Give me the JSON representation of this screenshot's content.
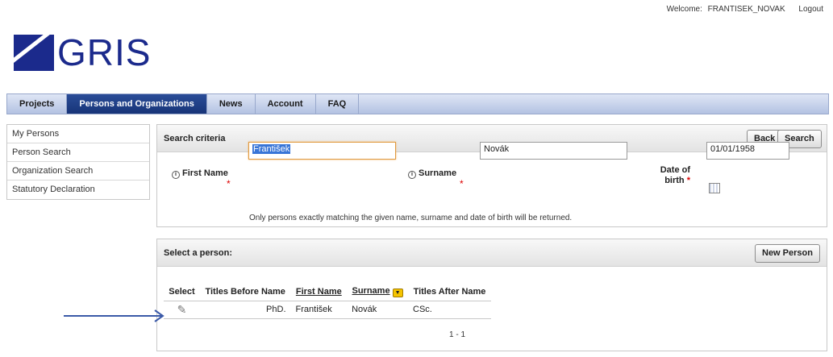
{
  "header": {
    "welcome_label": "Welcome:",
    "username": "FRANTISEK_NOVAK",
    "logout": "Logout"
  },
  "logo": {
    "text": "GRIS"
  },
  "tabs": [
    {
      "label": "Projects"
    },
    {
      "label": "Persons and Organizations"
    },
    {
      "label": "News"
    },
    {
      "label": "Account"
    },
    {
      "label": "FAQ"
    }
  ],
  "sidebar": {
    "items": [
      {
        "label": "My Persons"
      },
      {
        "label": "Person Search"
      },
      {
        "label": "Organization Search"
      },
      {
        "label": "Statutory Declaration"
      }
    ]
  },
  "search": {
    "title": "Search criteria",
    "back": "Back",
    "search": "Search",
    "first_name_label": "First Name",
    "first_name_value": "František",
    "surname_label": "Surname",
    "surname_value": "Novák",
    "dob_label_1": "Date of",
    "dob_label_2": "birth",
    "dob_value": "01/01/1958",
    "required_mark": "*",
    "info_glyph": "i",
    "hint": "Only persons exactly matching the given name, surname and date of birth will be returned."
  },
  "results": {
    "title": "Select a person:",
    "new_person": "New Person",
    "columns": [
      "Select",
      "Titles Before Name",
      "First Name",
      "Surname",
      "Titles After Name"
    ],
    "sort_glyph": "▼",
    "edit_glyph": "✎",
    "rows": [
      {
        "titles_before": "PhD.",
        "first_name": "František",
        "surname": "Novák",
        "titles_after": "CSc."
      }
    ],
    "pager": "1 - 1"
  },
  "colors": {
    "brand": "#1b2a8c",
    "tab_active": "#173478",
    "arrow": "#3b5aa8",
    "required": "#d00000"
  },
  "icons": [
    "info-icon",
    "calendar-icon",
    "sort-icon",
    "edit-icon",
    "arrow-icon"
  ]
}
